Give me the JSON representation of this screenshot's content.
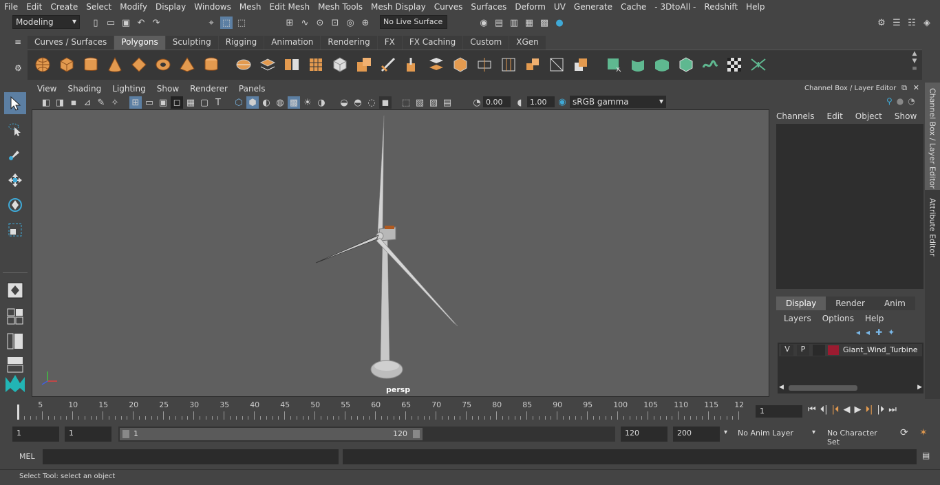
{
  "menubar": [
    "File",
    "Edit",
    "Create",
    "Select",
    "Modify",
    "Display",
    "Windows",
    "Mesh",
    "Edit Mesh",
    "Mesh Tools",
    "Mesh Display",
    "Curves",
    "Surfaces",
    "Deform",
    "UV",
    "Generate",
    "Cache",
    "- 3DtoAll -",
    "Redshift",
    "Help"
  ],
  "status": {
    "mode": "Modeling",
    "live_surface": "No Live Surface"
  },
  "shelf_tabs": [
    "Curves / Surfaces",
    "Polygons",
    "Sculpting",
    "Rigging",
    "Animation",
    "Rendering",
    "FX",
    "FX Caching",
    "Custom",
    "XGen"
  ],
  "shelf_active": "Polygons",
  "viewport_menu": [
    "View",
    "Shading",
    "Lighting",
    "Show",
    "Renderer",
    "Panels"
  ],
  "viewport_toolbar": {
    "exposure": "0.00",
    "gamma": "1.00",
    "colorspace": "sRGB gamma"
  },
  "viewport_label": "persp",
  "channel_box": {
    "title": "Channel Box / Layer Editor",
    "menu": [
      "Channels",
      "Edit",
      "Object",
      "Show"
    ],
    "layer_tabs": [
      "Display",
      "Render",
      "Anim"
    ],
    "layer_menu": [
      "Layers",
      "Options",
      "Help"
    ],
    "layer": {
      "v": "V",
      "p": "P",
      "name": "Giant_Wind_Turbine",
      "color": "#9b1b30"
    }
  },
  "side_tabs": [
    "Channel Box / Layer Editor",
    "Attribute Editor"
  ],
  "timeline": {
    "ticks": [
      "5",
      "10",
      "15",
      "20",
      "25",
      "30",
      "35",
      "40",
      "45",
      "50",
      "55",
      "60",
      "65",
      "70",
      "75",
      "80",
      "85",
      "90",
      "95",
      "100",
      "105",
      "110",
      "115",
      "12"
    ],
    "first": "1",
    "current_frame": "1"
  },
  "range": {
    "start": "1",
    "start2": "1",
    "slider_start": "1",
    "slider_end": "120",
    "end": "120",
    "end2": "200",
    "anim_layer": "No Anim Layer",
    "char_set": "No Character Set"
  },
  "cmdline": {
    "label": "MEL"
  },
  "help": "Select Tool: select an object"
}
